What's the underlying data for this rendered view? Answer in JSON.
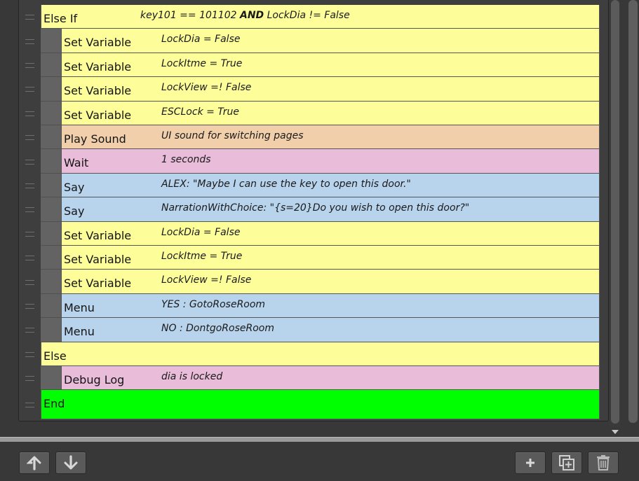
{
  "commands": [
    {
      "name": "Else If",
      "summary_html": "key101 == 101102 <b>AND</b> LockDia != False",
      "color": "yellow",
      "indent": 0
    },
    {
      "name": "Set Variable",
      "summary_html": "LockDia = False",
      "color": "yellow",
      "indent": 1
    },
    {
      "name": "Set Variable",
      "summary_html": "LockItme = True",
      "color": "yellow",
      "indent": 1
    },
    {
      "name": "Set Variable",
      "summary_html": "LockView =! False",
      "color": "yellow",
      "indent": 1
    },
    {
      "name": "Set Variable",
      "summary_html": "ESCLock = True",
      "color": "yellow",
      "indent": 1
    },
    {
      "name": "Play Sound",
      "summary_html": "UI sound for switching pages",
      "color": "orange",
      "indent": 1
    },
    {
      "name": "Wait",
      "summary_html": "1 seconds",
      "color": "pink",
      "indent": 1
    },
    {
      "name": "Say",
      "summary_html": "ALEX: \"Maybe I can use the key to open this door.\"",
      "color": "blue",
      "indent": 1
    },
    {
      "name": "Say",
      "summary_html": "NarrationWithChoice: \"{s=20}Do you wish to open this door?\"",
      "color": "blue",
      "indent": 1
    },
    {
      "name": "Set Variable",
      "summary_html": "LockDia = False",
      "color": "yellow",
      "indent": 1
    },
    {
      "name": "Set Variable",
      "summary_html": "LockItme = True",
      "color": "yellow",
      "indent": 1
    },
    {
      "name": "Set Variable",
      "summary_html": "LockView =! False",
      "color": "yellow",
      "indent": 1
    },
    {
      "name": "Menu",
      "summary_html": "YES : GotoRoseRoom",
      "color": "blue",
      "indent": 1
    },
    {
      "name": "Menu",
      "summary_html": "NO : DontgoRoseRoom",
      "color": "blue",
      "indent": 1
    },
    {
      "name": "Else",
      "summary_html": "",
      "color": "yellow",
      "indent": 0
    },
    {
      "name": "Debug Log",
      "summary_html": "dia is locked",
      "color": "pink",
      "indent": 1
    },
    {
      "name": "End",
      "summary_html": "",
      "color": "green",
      "indent": 0
    }
  ],
  "colors": {
    "yellow": "#fdfd9a",
    "orange": "#f0cfaa",
    "pink": "#e9bcd9",
    "blue": "#b8d3ec",
    "green": "#00ff00"
  },
  "toolbar": {
    "left": [
      {
        "name": "move-up-button",
        "icon": "arrow-up-icon"
      },
      {
        "name": "move-down-button",
        "icon": "arrow-down-icon"
      }
    ],
    "right": [
      {
        "name": "add-command-button",
        "icon": "plus-icon"
      },
      {
        "name": "duplicate-command-button",
        "icon": "duplicate-icon"
      },
      {
        "name": "delete-command-button",
        "icon": "trash-icon"
      }
    ]
  }
}
